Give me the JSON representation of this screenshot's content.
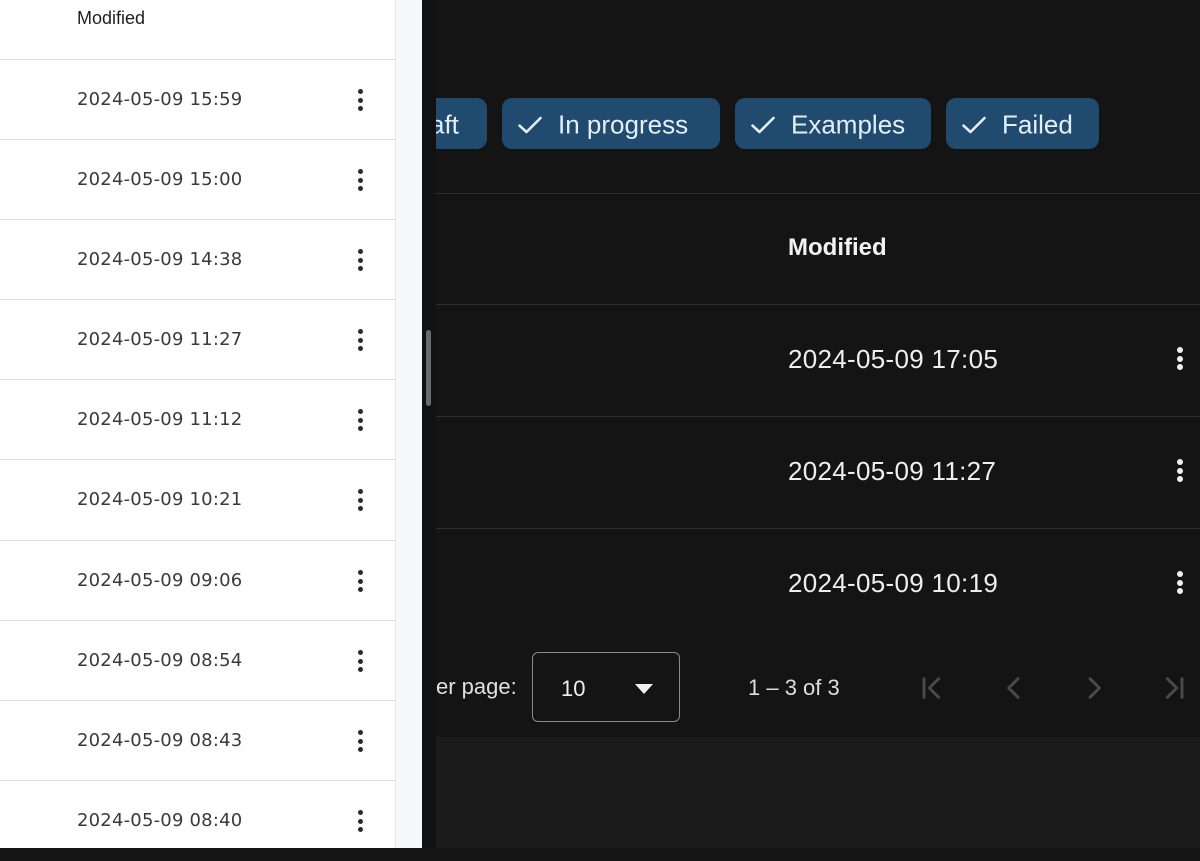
{
  "left_panel": {
    "header": "Modified",
    "rows": [
      {
        "modified": "2024-05-09 15:59"
      },
      {
        "modified": "2024-05-09 15:00"
      },
      {
        "modified": "2024-05-09 14:38"
      },
      {
        "modified": "2024-05-09 11:27"
      },
      {
        "modified": "2024-05-09 11:12"
      },
      {
        "modified": "2024-05-09 10:21"
      },
      {
        "modified": "2024-05-09 09:06"
      },
      {
        "modified": "2024-05-09 08:54"
      },
      {
        "modified": "2024-05-09 08:43"
      },
      {
        "modified": "2024-05-09 08:40"
      }
    ],
    "icons": {
      "row_menu": "more-vert-icon"
    }
  },
  "right_panel": {
    "filter_chips": [
      {
        "label": "aft",
        "selected": true
      },
      {
        "label": "In progress",
        "selected": true
      },
      {
        "label": "Examples",
        "selected": true
      },
      {
        "label": "Failed",
        "selected": true
      }
    ],
    "header": "Modified",
    "rows": [
      {
        "modified": "2024-05-09 17:05"
      },
      {
        "modified": "2024-05-09 11:27"
      },
      {
        "modified": "2024-05-09 10:19"
      }
    ],
    "paginator": {
      "rows_per_page_label": "er page:",
      "page_size": "10",
      "range_label": "1 – 3 of 3",
      "icons": [
        "first-page-icon",
        "chevron-left-icon",
        "chevron-right-icon",
        "last-page-icon"
      ]
    }
  },
  "colors": {
    "chip_background": "#204a6e",
    "dark_background": "#141414",
    "light_background": "#ffffff"
  }
}
